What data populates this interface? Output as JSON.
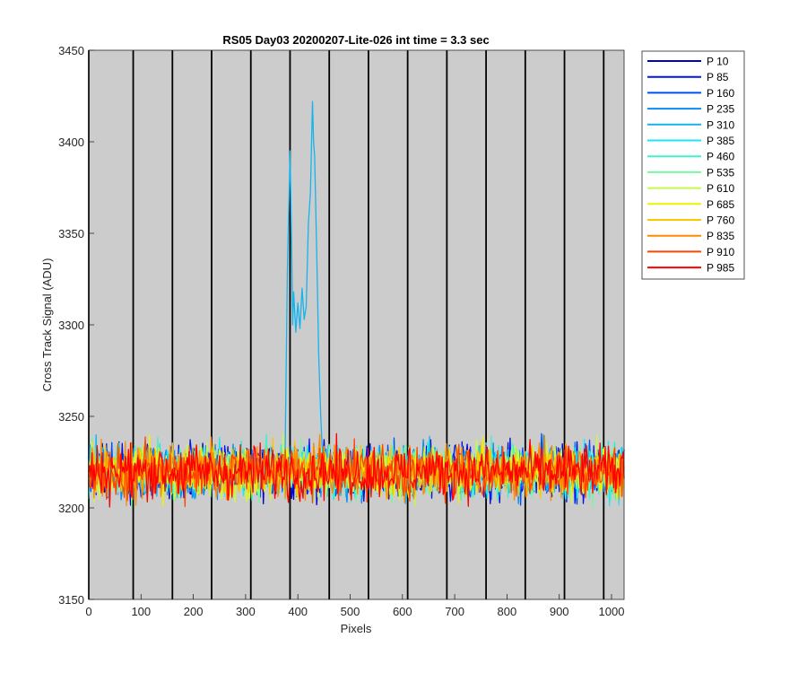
{
  "chart_data": {
    "type": "line",
    "title": "RS05 Day03 20200207-Lite-026 int time = 3.3 sec",
    "xlabel": "Pixels",
    "ylabel": "Cross Track Signal (ADU)",
    "xlim": [
      0,
      1024
    ],
    "ylim": [
      3150,
      3450
    ],
    "xticks": [
      0,
      100,
      200,
      300,
      400,
      500,
      600,
      700,
      800,
      900,
      1000
    ],
    "yticks": [
      3150,
      3200,
      3250,
      3300,
      3350,
      3400,
      3450
    ],
    "grid": false,
    "legend_position": "outside-top-right",
    "background_color": "#cccccc",
    "column_boundaries": [
      0,
      85,
      160,
      235,
      310,
      385,
      460,
      535,
      610,
      685,
      760,
      835,
      910,
      985
    ],
    "noise_band": {
      "center": 3220,
      "low": 3200,
      "high": 3243
    },
    "series": [
      {
        "name": "P 10",
        "color": "#0000c8"
      },
      {
        "name": "P 85",
        "color": "#0016e6"
      },
      {
        "name": "P 160",
        "color": "#0050f0"
      },
      {
        "name": "P 235",
        "color": "#0a8cf0"
      },
      {
        "name": "P 310",
        "color": "#14b4ee",
        "feature": {
          "x": [
            375,
            380,
            385,
            388,
            390,
            392,
            396,
            400,
            404,
            408,
            412,
            416,
            420,
            424,
            428,
            430,
            432,
            436,
            440,
            444,
            448
          ],
          "y": [
            3215,
            3330,
            3395,
            3345,
            3300,
            3318,
            3296,
            3312,
            3298,
            3320,
            3303,
            3310,
            3355,
            3372,
            3422,
            3400,
            3392,
            3340,
            3282,
            3248,
            3224
          ]
        }
      },
      {
        "name": "P 385",
        "color": "#1ee6f0"
      },
      {
        "name": "P 460",
        "color": "#46f0c8"
      },
      {
        "name": "P 535",
        "color": "#78f8a0"
      },
      {
        "name": "P 610",
        "color": "#c8fa46"
      },
      {
        "name": "P 685",
        "color": "#f0f000"
      },
      {
        "name": "P 760",
        "color": "#f8c800"
      },
      {
        "name": "P 835",
        "color": "#ff8c00"
      },
      {
        "name": "P 910",
        "color": "#ff4600"
      },
      {
        "name": "P 985",
        "color": "#ff0000"
      }
    ]
  }
}
